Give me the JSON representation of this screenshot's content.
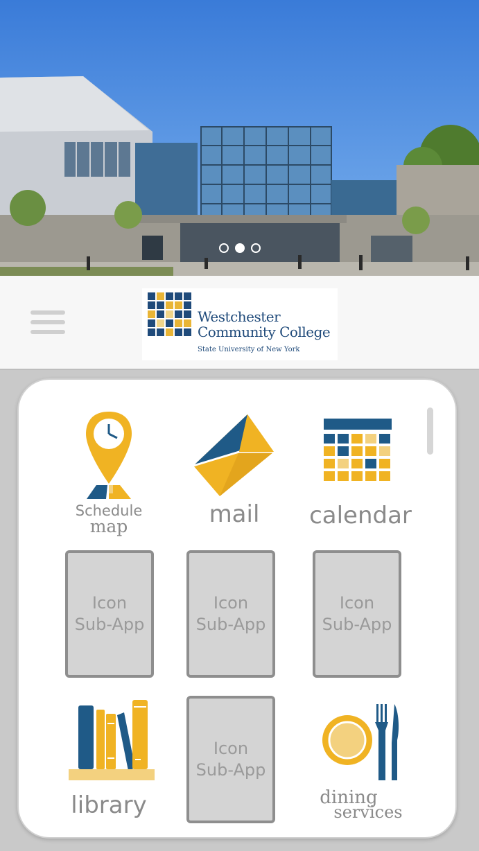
{
  "carousel": {
    "slides": 3,
    "active_index": 1
  },
  "header": {
    "logo": {
      "name_line1": "Westchester",
      "name_line2": "Community College",
      "subtitle": "State University of New York"
    }
  },
  "apps": [
    {
      "id": "schedule-map",
      "label_line1": "Schedule",
      "label_line2": "map",
      "icon": "map-pin-clock-icon"
    },
    {
      "id": "mail",
      "label": "mail",
      "icon": "envelope-icon"
    },
    {
      "id": "calendar",
      "label": "calendar",
      "icon": "calendar-icon"
    },
    {
      "id": "library",
      "label": "library",
      "icon": "books-icon"
    },
    {
      "id": "dining",
      "label_line1": "dining",
      "label_line2": "services",
      "icon": "plate-fork-knife-icon"
    }
  ],
  "sub_app_placeholder": {
    "line1": "Icon",
    "line2": "Sub-App"
  },
  "colors": {
    "navy": "#1f5a87",
    "gold": "#f0b323",
    "light_gold": "#f3d17f",
    "label_gray": "#8a8a8a",
    "placeholder_bg": "#d4d4d4"
  }
}
